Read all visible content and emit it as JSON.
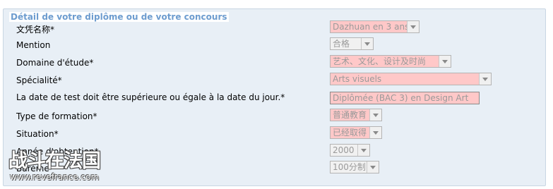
{
  "section": {
    "title": "Détail de votre diplôme ou de votre concours"
  },
  "fields": [
    {
      "label": "文凭名称*",
      "value": "Dazhuan en 3 ans",
      "kind": "select",
      "required": true
    },
    {
      "label": "Mention",
      "value": "合格",
      "kind": "select",
      "required": false
    },
    {
      "label": "Domaine d'étude*",
      "value": "艺术、文化、设计及时尚",
      "kind": "select",
      "required": true
    },
    {
      "label": "Spécialité*",
      "value": "Arts visuels",
      "kind": "select",
      "required": true
    },
    {
      "label": "La date de test doit être supérieure ou égale à la date du jour.*",
      "value": "Diplômée (BAC 3) en Design Art",
      "kind": "input",
      "required": true
    },
    {
      "label": "Type de formation*",
      "value": "普通教育",
      "kind": "select",
      "required": true
    },
    {
      "label": "Situation*",
      "value": "已经取得",
      "kind": "select",
      "required": true
    },
    {
      "label": "Année d'obtention*",
      "value": "2000",
      "kind": "select",
      "required": false
    },
    {
      "label": "Barème",
      "value": "100分制",
      "kind": "select",
      "required": false
    }
  ],
  "watermark": {
    "logo": "战斗在法国",
    "site": "www.revefrance.com"
  },
  "colors": {
    "panel_bg": "#e8eff6",
    "legend_text": "#6d9ccf",
    "required_bg": "#ffc8c8",
    "disabled_bg": "#f1f1f1"
  }
}
